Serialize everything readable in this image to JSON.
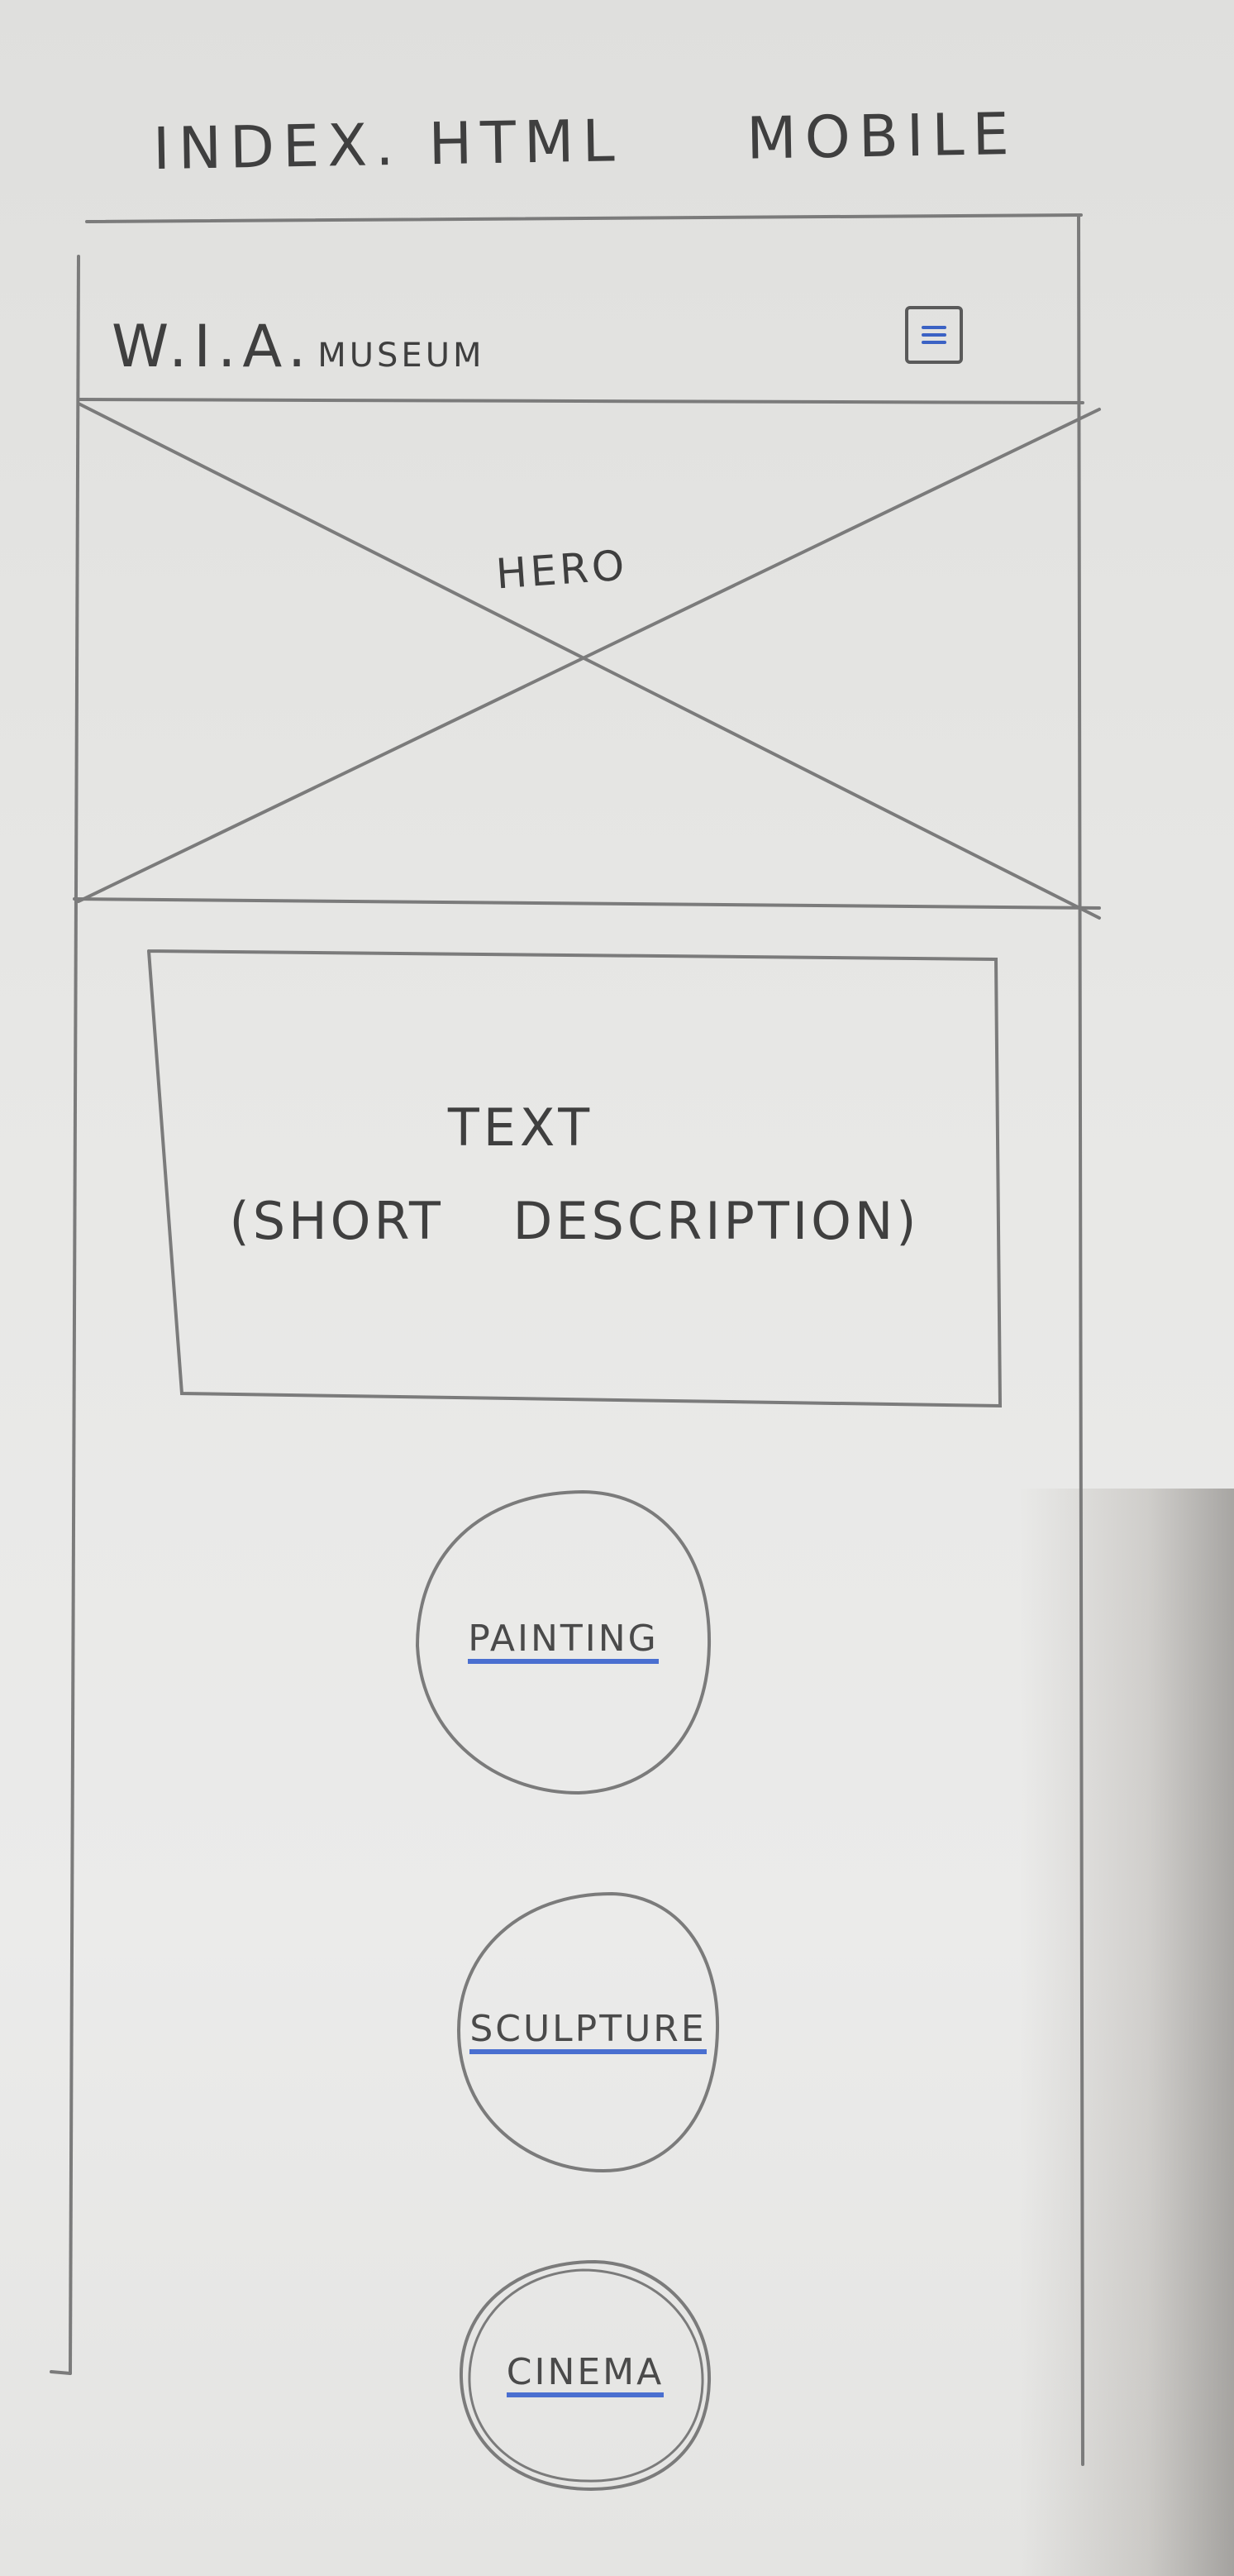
{
  "header": {
    "file_label": "INDEX.",
    "file_ext": "HTML",
    "viewport": "MOBILE"
  },
  "navbar": {
    "brand": "W.I.A.",
    "brand_sub": "MUSEUM",
    "menu_icon": "hamburger-menu-icon"
  },
  "hero": {
    "label": "HERO"
  },
  "intro": {
    "title": "TEXT",
    "subtitle": "(SHORT DESCRIPTION)"
  },
  "categories": [
    {
      "label": "PAINTING"
    },
    {
      "label": "SCULPTURE"
    },
    {
      "label": "CINEMA"
    }
  ],
  "colors": {
    "pencil": "#5a5a5a",
    "link_underline": "#4a6fd0",
    "paper": "#e6e6e4"
  }
}
